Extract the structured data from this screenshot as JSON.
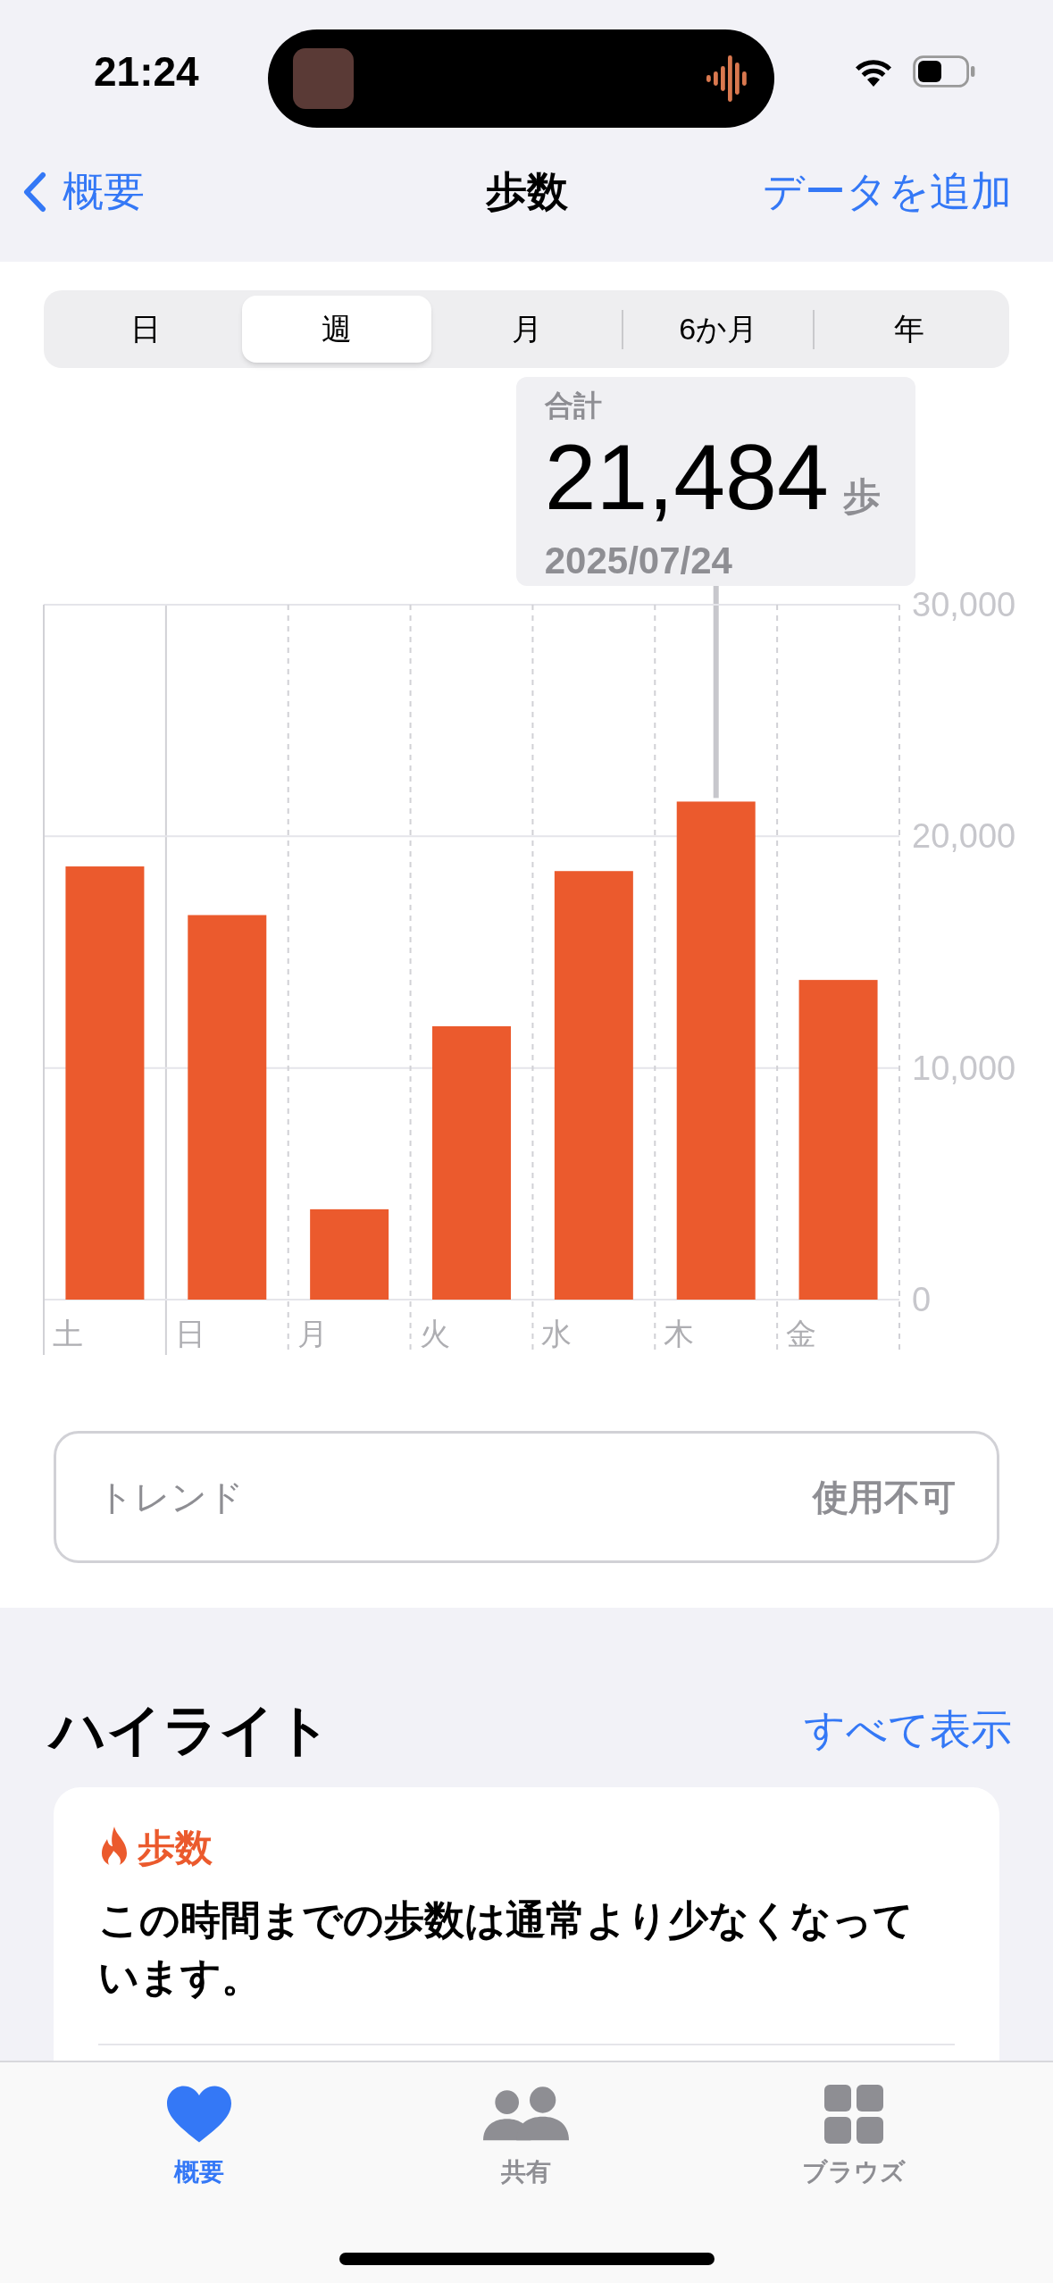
{
  "status_bar": {
    "time": "21:24"
  },
  "nav": {
    "back": "概要",
    "title": "歩数",
    "action": "データを追加"
  },
  "segments": [
    {
      "label": "日",
      "selected": false
    },
    {
      "label": "週",
      "selected": true
    },
    {
      "label": "月",
      "selected": false
    },
    {
      "label": "6か月",
      "selected": false
    },
    {
      "label": "年",
      "selected": false
    }
  ],
  "summary": {
    "label": "合計",
    "value": "21,484",
    "unit": "歩",
    "date": "2025/07/24"
  },
  "chart": {
    "highlighted": [
      false,
      false,
      false,
      false,
      false,
      true,
      false
    ],
    "chart_data": {
      "type": "bar",
      "categories": [
        "土",
        "日",
        "月",
        "火",
        "水",
        "木",
        "金"
      ],
      "series": [
        {
          "color": "#eb5a2d",
          "values": [
            18700,
            16600,
            3900,
            11800,
            18500,
            21500,
            13800
          ]
        }
      ],
      "ylim": [
        0,
        30000
      ],
      "yticks": [
        {
          "value": 0,
          "label": "0"
        },
        {
          "value": 10000,
          "label": "10,000"
        },
        {
          "value": 20000,
          "label": "20,000"
        },
        {
          "value": 30000,
          "label": "30,000"
        }
      ]
    }
  },
  "trend": {
    "label": "トレンド",
    "value": "使用不可"
  },
  "highlights": {
    "title": "ハイライト",
    "action": "すべて表示",
    "card": {
      "title": "歩数",
      "body": "この時間までの歩数は通常より少なくなっています。"
    }
  },
  "tab_bar": [
    {
      "label": "概要",
      "selected": true
    },
    {
      "label": "共有",
      "selected": false
    },
    {
      "label": "ブラウズ",
      "selected": false
    }
  ]
}
